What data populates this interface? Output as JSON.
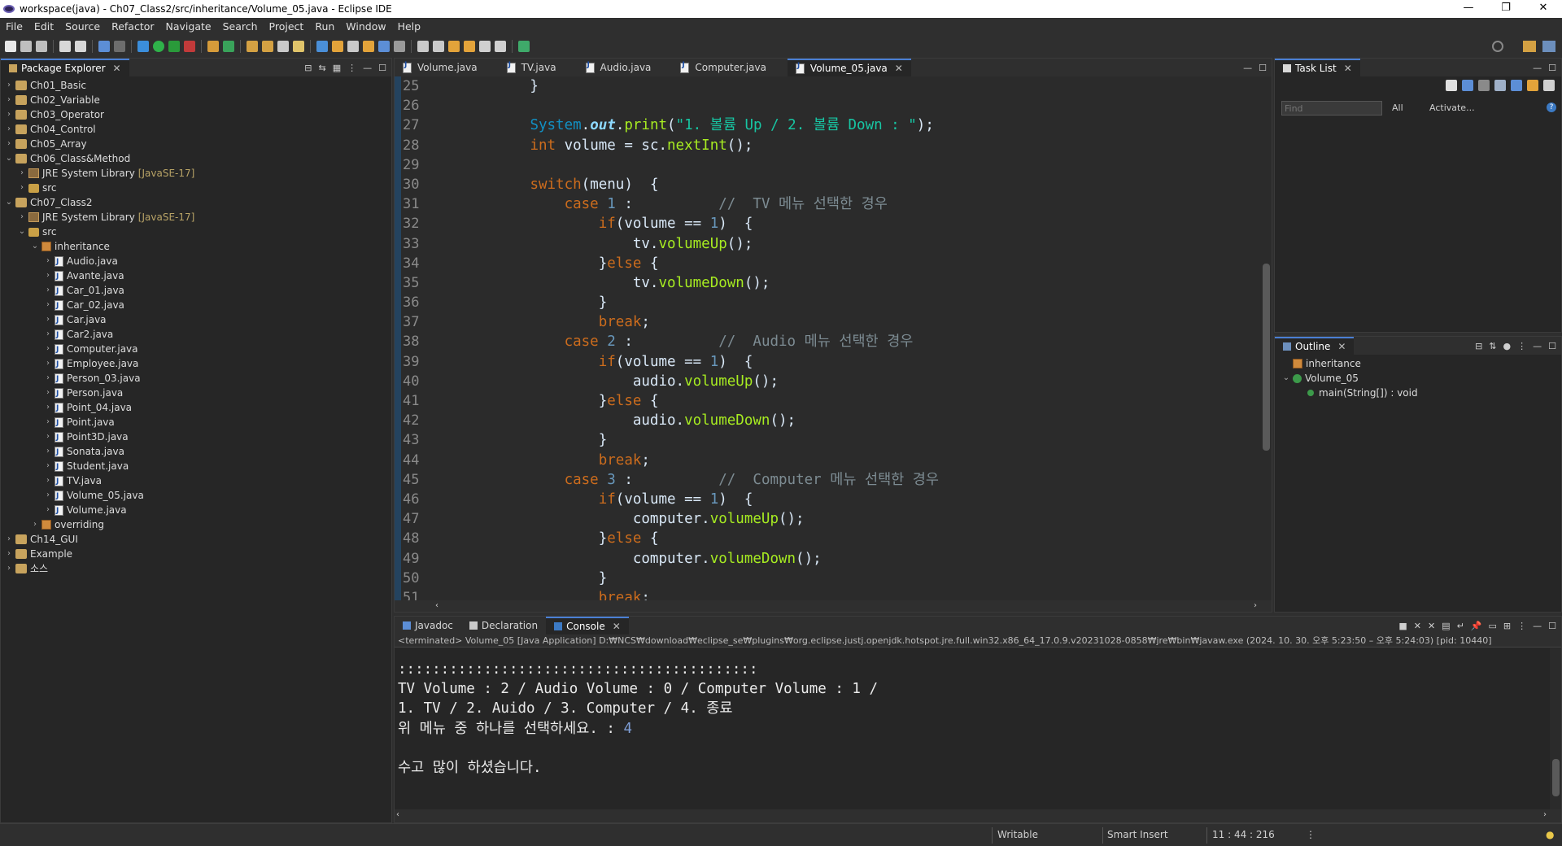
{
  "window": {
    "title": "workspace(java) - Ch07_Class2/src/inheritance/Volume_05.java - Eclipse IDE",
    "controls": [
      "—",
      "❐",
      "✕"
    ]
  },
  "menu": [
    "File",
    "Edit",
    "Source",
    "Refactor",
    "Navigate",
    "Search",
    "Project",
    "Run",
    "Window",
    "Help"
  ],
  "package_explorer": {
    "title": "Package Explorer",
    "items": [
      {
        "label": "Ch01_Basic",
        "kind": "project",
        "indent": 0,
        "chev": "›"
      },
      {
        "label": "Ch02_Variable",
        "kind": "project",
        "indent": 0,
        "chev": "›"
      },
      {
        "label": "Ch03_Operator",
        "kind": "project",
        "indent": 0,
        "chev": "›"
      },
      {
        "label": "Ch04_Control",
        "kind": "project",
        "indent": 0,
        "chev": "›"
      },
      {
        "label": "Ch05_Array",
        "kind": "project",
        "indent": 0,
        "chev": "›"
      },
      {
        "label": "Ch06_Class&Method",
        "kind": "project",
        "indent": 0,
        "chev": "⌄"
      },
      {
        "label": "JRE System Library",
        "kind": "lib",
        "indent": 1,
        "chev": "›",
        "extra": "[JavaSE-17]"
      },
      {
        "label": "src",
        "kind": "src",
        "indent": 1,
        "chev": "›"
      },
      {
        "label": "Ch07_Class2",
        "kind": "project",
        "indent": 0,
        "chev": "⌄"
      },
      {
        "label": "JRE System Library",
        "kind": "lib",
        "indent": 1,
        "chev": "›",
        "extra": "[JavaSE-17]"
      },
      {
        "label": "src",
        "kind": "src",
        "indent": 1,
        "chev": "⌄"
      },
      {
        "label": "inheritance",
        "kind": "pkg",
        "indent": 2,
        "chev": "⌄"
      },
      {
        "label": "Audio.java",
        "kind": "java",
        "indent": 3,
        "chev": "›"
      },
      {
        "label": "Avante.java",
        "kind": "java",
        "indent": 3,
        "chev": "›"
      },
      {
        "label": "Car_01.java",
        "kind": "java",
        "indent": 3,
        "chev": "›"
      },
      {
        "label": "Car_02.java",
        "kind": "java",
        "indent": 3,
        "chev": "›"
      },
      {
        "label": "Car.java",
        "kind": "java",
        "indent": 3,
        "chev": "›"
      },
      {
        "label": "Car2.java",
        "kind": "java",
        "indent": 3,
        "chev": "›"
      },
      {
        "label": "Computer.java",
        "kind": "java",
        "indent": 3,
        "chev": "›"
      },
      {
        "label": "Employee.java",
        "kind": "java",
        "indent": 3,
        "chev": "›"
      },
      {
        "label": "Person_03.java",
        "kind": "java",
        "indent": 3,
        "chev": "›"
      },
      {
        "label": "Person.java",
        "kind": "java",
        "indent": 3,
        "chev": "›"
      },
      {
        "label": "Point_04.java",
        "kind": "java",
        "indent": 3,
        "chev": "›"
      },
      {
        "label": "Point.java",
        "kind": "java",
        "indent": 3,
        "chev": "›"
      },
      {
        "label": "Point3D.java",
        "kind": "java",
        "indent": 3,
        "chev": "›"
      },
      {
        "label": "Sonata.java",
        "kind": "java",
        "indent": 3,
        "chev": "›"
      },
      {
        "label": "Student.java",
        "kind": "java",
        "indent": 3,
        "chev": "›"
      },
      {
        "label": "TV.java",
        "kind": "java",
        "indent": 3,
        "chev": "›"
      },
      {
        "label": "Volume_05.java",
        "kind": "java",
        "indent": 3,
        "chev": "›"
      },
      {
        "label": "Volume.java",
        "kind": "java",
        "indent": 3,
        "chev": "›"
      },
      {
        "label": "overriding",
        "kind": "pkg",
        "indent": 2,
        "chev": "›"
      },
      {
        "label": "Ch14_GUI",
        "kind": "project",
        "indent": 0,
        "chev": "›"
      },
      {
        "label": "Example",
        "kind": "project",
        "indent": 0,
        "chev": "›"
      },
      {
        "label": "소스",
        "kind": "project",
        "indent": 0,
        "chev": "›"
      }
    ]
  },
  "editor": {
    "tabs": [
      {
        "label": "Volume.java",
        "active": false
      },
      {
        "label": "TV.java",
        "active": false
      },
      {
        "label": "Audio.java",
        "active": false
      },
      {
        "label": "Computer.java",
        "active": false
      },
      {
        "label": "Volume_05.java",
        "active": true
      }
    ],
    "lines": [
      {
        "n": "25",
        "tokens": [
          [
            "t",
            "            }"
          ]
        ]
      },
      {
        "n": "26",
        "tokens": []
      },
      {
        "n": "27",
        "tokens": [
          [
            "t",
            "            "
          ],
          [
            "cls",
            "System"
          ],
          [
            "t",
            "."
          ],
          [
            "fld",
            "out"
          ],
          [
            "t",
            "."
          ],
          [
            "meth",
            "print"
          ],
          [
            "t",
            "("
          ],
          [
            "str",
            "\"1. 볼륨 Up / 2. 볼륨 Down : \""
          ],
          [
            "t",
            ");"
          ]
        ]
      },
      {
        "n": "28",
        "tokens": [
          [
            "t",
            "            "
          ],
          [
            "kw",
            "int"
          ],
          [
            "t",
            " volume = sc."
          ],
          [
            "meth",
            "nextInt"
          ],
          [
            "t",
            "();"
          ]
        ]
      },
      {
        "n": "29",
        "tokens": []
      },
      {
        "n": "30",
        "tokens": [
          [
            "t",
            "            "
          ],
          [
            "kw",
            "switch"
          ],
          [
            "t",
            "(menu)  {"
          ]
        ]
      },
      {
        "n": "31",
        "tokens": [
          [
            "t",
            "                "
          ],
          [
            "kw",
            "case"
          ],
          [
            "t",
            " "
          ],
          [
            "num",
            "1"
          ],
          [
            "t",
            " :          "
          ],
          [
            "cmt",
            "//  TV 메뉴 선택한 경우"
          ]
        ]
      },
      {
        "n": "32",
        "tokens": [
          [
            "t",
            "                    "
          ],
          [
            "kw",
            "if"
          ],
          [
            "t",
            "(volume == "
          ],
          [
            "num",
            "1"
          ],
          [
            "t",
            ")  {"
          ]
        ]
      },
      {
        "n": "33",
        "tokens": [
          [
            "t",
            "                        tv."
          ],
          [
            "meth",
            "volumeUp"
          ],
          [
            "t",
            "();"
          ]
        ]
      },
      {
        "n": "34",
        "tokens": [
          [
            "t",
            "                    }"
          ],
          [
            "kw",
            "else"
          ],
          [
            "t",
            " {"
          ]
        ]
      },
      {
        "n": "35",
        "tokens": [
          [
            "t",
            "                        tv."
          ],
          [
            "meth",
            "volumeDown"
          ],
          [
            "t",
            "();"
          ]
        ]
      },
      {
        "n": "36",
        "tokens": [
          [
            "t",
            "                    }"
          ]
        ]
      },
      {
        "n": "37",
        "tokens": [
          [
            "t",
            "                    "
          ],
          [
            "kw",
            "break"
          ],
          [
            "t",
            ";"
          ]
        ]
      },
      {
        "n": "38",
        "tokens": [
          [
            "t",
            "                "
          ],
          [
            "kw",
            "case"
          ],
          [
            "t",
            " "
          ],
          [
            "num",
            "2"
          ],
          [
            "t",
            " :          "
          ],
          [
            "cmt",
            "//  Audio 메뉴 선택한 경우"
          ]
        ]
      },
      {
        "n": "39",
        "tokens": [
          [
            "t",
            "                    "
          ],
          [
            "kw",
            "if"
          ],
          [
            "t",
            "(volume == "
          ],
          [
            "num",
            "1"
          ],
          [
            "t",
            ")  {"
          ]
        ]
      },
      {
        "n": "40",
        "tokens": [
          [
            "t",
            "                        audio."
          ],
          [
            "meth",
            "volumeUp"
          ],
          [
            "t",
            "();"
          ]
        ]
      },
      {
        "n": "41",
        "tokens": [
          [
            "t",
            "                    }"
          ],
          [
            "kw",
            "else"
          ],
          [
            "t",
            " {"
          ]
        ]
      },
      {
        "n": "42",
        "tokens": [
          [
            "t",
            "                        audio."
          ],
          [
            "meth",
            "volumeDown"
          ],
          [
            "t",
            "();"
          ]
        ]
      },
      {
        "n": "43",
        "tokens": [
          [
            "t",
            "                    }"
          ]
        ]
      },
      {
        "n": "44",
        "tokens": [
          [
            "t",
            "                    "
          ],
          [
            "kw",
            "break"
          ],
          [
            "t",
            ";"
          ]
        ]
      },
      {
        "n": "45",
        "tokens": [
          [
            "t",
            "                "
          ],
          [
            "kw",
            "case"
          ],
          [
            "t",
            " "
          ],
          [
            "num",
            "3"
          ],
          [
            "t",
            " :          "
          ],
          [
            "cmt",
            "//  Computer 메뉴 선택한 경우"
          ]
        ]
      },
      {
        "n": "46",
        "tokens": [
          [
            "t",
            "                    "
          ],
          [
            "kw",
            "if"
          ],
          [
            "t",
            "(volume == "
          ],
          [
            "num",
            "1"
          ],
          [
            "t",
            ")  {"
          ]
        ]
      },
      {
        "n": "47",
        "tokens": [
          [
            "t",
            "                        computer."
          ],
          [
            "meth",
            "volumeUp"
          ],
          [
            "t",
            "();"
          ]
        ]
      },
      {
        "n": "48",
        "tokens": [
          [
            "t",
            "                    }"
          ],
          [
            "kw",
            "else"
          ],
          [
            "t",
            " {"
          ]
        ]
      },
      {
        "n": "49",
        "tokens": [
          [
            "t",
            "                        computer."
          ],
          [
            "meth",
            "volumeDown"
          ],
          [
            "t",
            "();"
          ]
        ]
      },
      {
        "n": "50",
        "tokens": [
          [
            "t",
            "                    }"
          ]
        ]
      },
      {
        "n": "51",
        "tokens": [
          [
            "t",
            "                    "
          ],
          [
            "kw",
            "break"
          ],
          [
            "t",
            ";"
          ]
        ]
      }
    ]
  },
  "task_list": {
    "title": "Task List",
    "find_placeholder": "Find",
    "all_label": "All",
    "activate_label": "Activate..."
  },
  "outline": {
    "title": "Outline",
    "items": [
      {
        "label": "inheritance",
        "indent": 0,
        "chev": ""
      },
      {
        "label": "Volume_05",
        "indent": 0,
        "chev": "⌄"
      },
      {
        "label": "main(String[]) : void",
        "indent": 1,
        "chev": ""
      }
    ]
  },
  "bottom_tabs": [
    {
      "label": "Javadoc",
      "active": false
    },
    {
      "label": "Declaration",
      "active": false
    },
    {
      "label": "Console",
      "active": true
    }
  ],
  "console": {
    "meta": "<terminated> Volume_05 [Java Application] D:₩NCS₩download₩eclipse_se₩plugins₩org.eclipse.justj.openjdk.hotspot.jre.full.win32.x86_64_17.0.9.v20231028-0858₩jre₩bin₩javaw.exe  (2024. 10. 30. 오후 5:23:50 – 오후 5:24:03) [pid: 10440]",
    "lines": [
      {
        "text": "::::::::::::::::::::::::::::::::::::::::::",
        "input": ""
      },
      {
        "text": "TV Volume : 2 / Audio Volume : 0 / Computer Volume : 1 /",
        "input": ""
      },
      {
        "text": "1. TV / 2. Auido / 3. Computer / 4. 종료",
        "input": ""
      },
      {
        "text": "위 메뉴 중 하나를 선택하세요. : ",
        "input": "4"
      },
      {
        "text": "",
        "input": ""
      },
      {
        "text": "수고 많이 하셨습니다.",
        "input": ""
      }
    ]
  },
  "status": {
    "writable": "Writable",
    "insert_mode": "Smart Insert",
    "position": "11 : 44 : 216"
  }
}
